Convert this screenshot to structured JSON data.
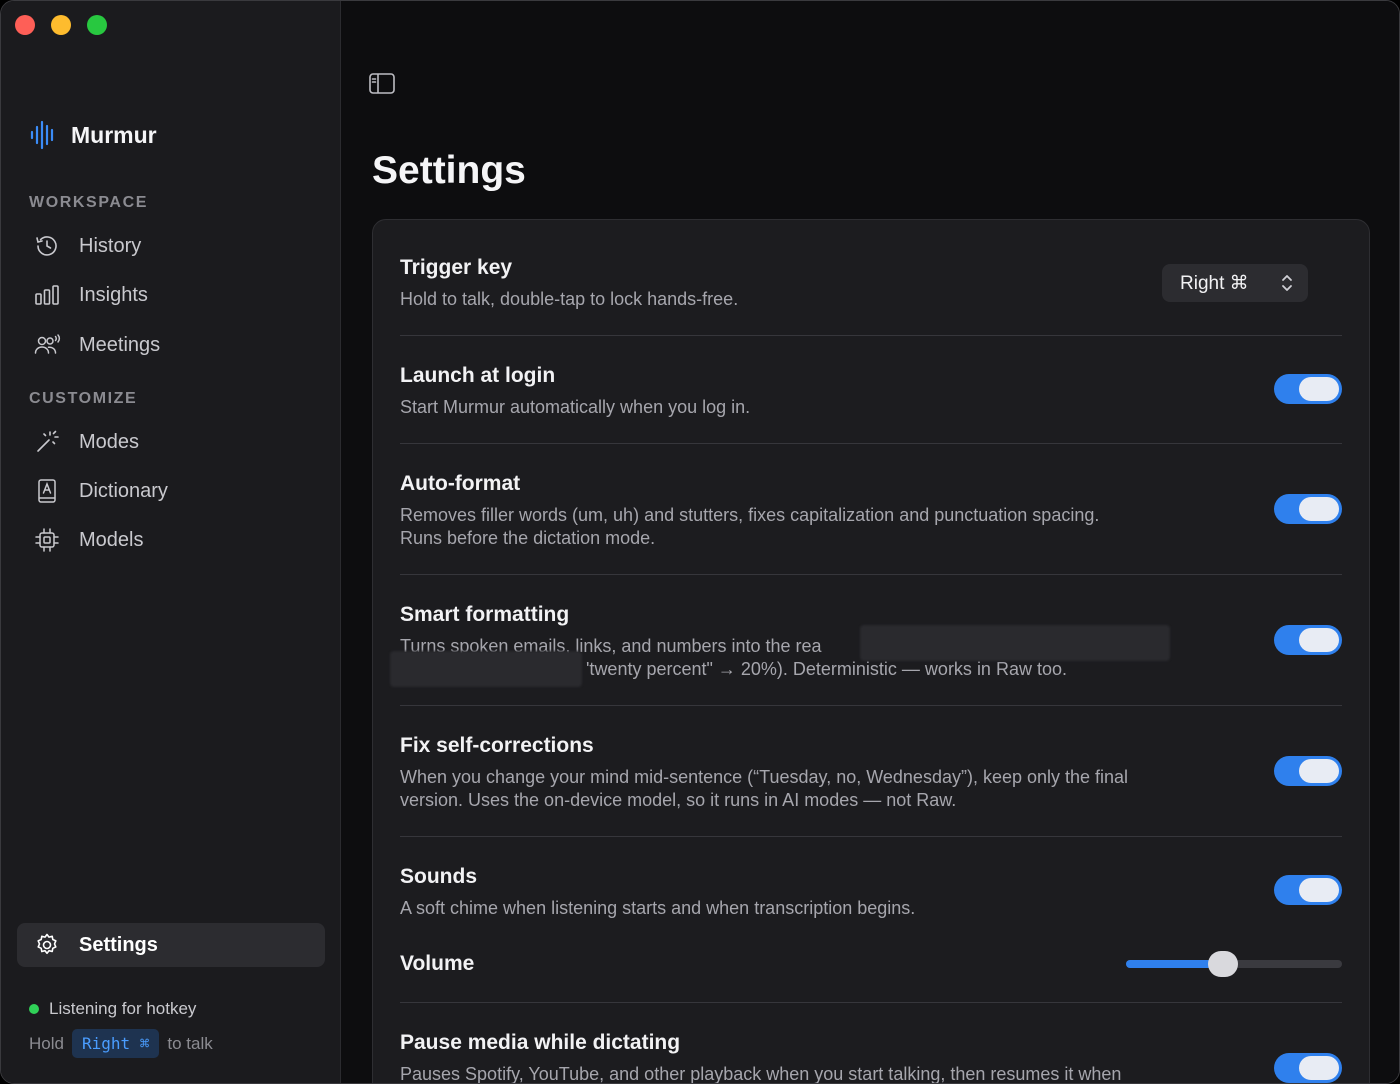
{
  "app": {
    "name": "Murmur"
  },
  "colors": {
    "accent": "#2f80ed",
    "status_ok": "#30d158"
  },
  "sidebar": {
    "sections": [
      {
        "label": "WORKSPACE"
      },
      {
        "label": "CUSTOMIZE"
      }
    ],
    "items": [
      {
        "label": "History",
        "icon": "history-icon"
      },
      {
        "label": "Insights",
        "icon": "bar-chart-icon"
      },
      {
        "label": "Meetings",
        "icon": "people-icon"
      },
      {
        "label": "Modes",
        "icon": "magic-wand-icon"
      },
      {
        "label": "Dictionary",
        "icon": "book-icon"
      },
      {
        "label": "Models",
        "icon": "chip-icon"
      },
      {
        "label": "Settings",
        "icon": "gear-icon",
        "active": true
      }
    ],
    "status": "Listening for hotkey",
    "hint": {
      "prefix": "Hold",
      "key": "Right ⌘",
      "suffix": "to talk"
    }
  },
  "main": {
    "title": "Settings",
    "settings": [
      {
        "title": "Trigger key",
        "desc": "Hold to talk, double-tap to lock hands-free.",
        "control": "select",
        "value": "Right ⌘"
      },
      {
        "title": "Launch at login",
        "desc": "Start Murmur automatically when you log in.",
        "control": "toggle",
        "on": true
      },
      {
        "title": "Auto-format",
        "desc_line1": "Removes filler words (um, uh) and stutters, fixes capitalization and punctuation spacing.",
        "desc_line2": "Runs before the dictation mode.",
        "control": "toggle",
        "on": true
      },
      {
        "title": "Smart formatting",
        "desc_line1": "Turns spoken emails, links, and numbers into the rea",
        "desc_line2": "'twenty percent\" → 20%). Deterministic — works in Raw too.",
        "control": "toggle",
        "on": true
      },
      {
        "title": "Fix self-corrections",
        "desc_line1": "When you change your mind mid-sentence (“Tuesday, no, Wednesday”), keep only the final",
        "desc_line2": "version. Uses the on-device model, so it runs in AI modes — not Raw.",
        "control": "toggle",
        "on": true
      },
      {
        "title": "Sounds",
        "desc": "A soft chime when listening starts and when transcription begins.",
        "control": "toggle",
        "on": true
      },
      {
        "title": "Volume",
        "control": "slider",
        "value": 0.45
      },
      {
        "title": "Pause media while dictating",
        "desc": "Pauses Spotify, YouTube, and other playback when you start talking, then resumes it when",
        "control": "toggle",
        "on": true
      }
    ]
  }
}
